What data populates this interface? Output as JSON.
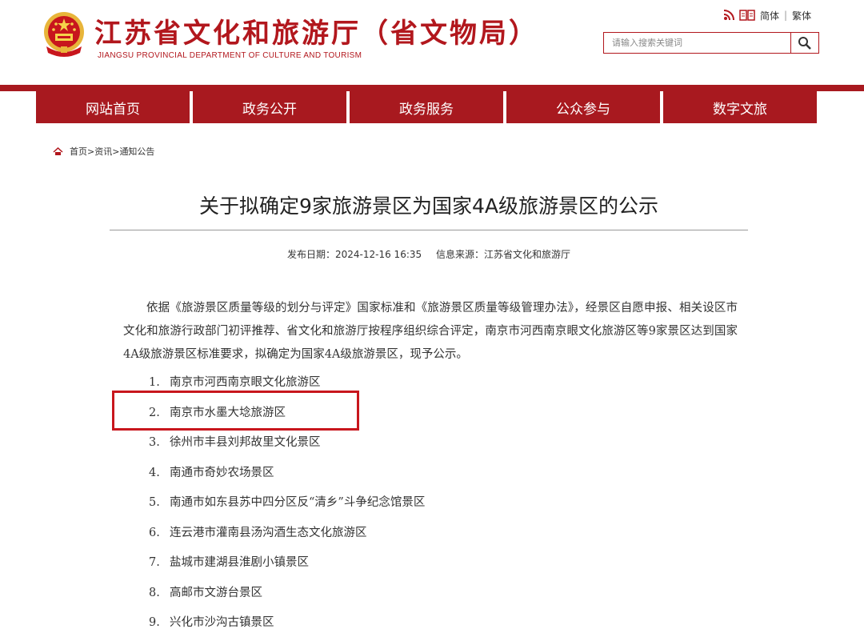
{
  "header": {
    "title": "江苏省文化和旅游厅（省文物局）",
    "subtitle": "JIANGSU PROVINCIAL DEPARTMENT OF CULTURE AND TOURISM",
    "tools": {
      "simplified": "简体",
      "separator": "|",
      "traditional": "繁体"
    },
    "search": {
      "placeholder": "请输入搜索关键词"
    }
  },
  "nav": {
    "items": [
      "网站首页",
      "政务公开",
      "政务服务",
      "公众参与",
      "数字文旅"
    ]
  },
  "breadcrumb": {
    "home": "首页",
    "sep": ">",
    "level1": "资讯",
    "level2": "通知公告"
  },
  "article": {
    "title": "关于拟确定9家旅游景区为国家4A级旅游景区的公示",
    "date_label": "发布日期：2024-12-16  16:35",
    "source_label": "信息来源：江苏省文化和旅游厅",
    "body": "依据《旅游景区质量等级的划分与评定》国家标准和《旅游景区质量等级管理办法》，经景区自愿申报、相关设区市文化和旅游行政部门初评推荐、省文化和旅游厅按程序组织综合评定，南京市河西南京眼文化旅游区等9家景区达到国家4A级旅游景区标准要求，拟确定为国家4A级旅游景区，现予公示。",
    "list": [
      {
        "num": "1.",
        "name": "南京市河西南京眼文化旅游区"
      },
      {
        "num": "2.",
        "name": "南京市水墨大埝旅游区"
      },
      {
        "num": "3.",
        "name": "徐州市丰县刘邦故里文化景区"
      },
      {
        "num": "4.",
        "name": "南通市奇妙农场景区"
      },
      {
        "num": "5.",
        "name": "南通市如东县苏中四分区反“清乡”斗争纪念馆景区"
      },
      {
        "num": "6.",
        "name": "连云港市灌南县汤沟酒生态文化旅游区"
      },
      {
        "num": "7.",
        "name": "盐城市建湖县淮剧小镇景区"
      },
      {
        "num": "8.",
        "name": "高邮市文游台景区"
      },
      {
        "num": "9.",
        "name": "兴化市沙沟古镇景区"
      }
    ]
  },
  "colors": {
    "brand_red": "#a8191f",
    "highlight_red": "#c8161d",
    "emblem_gold": "#e8b53a"
  }
}
